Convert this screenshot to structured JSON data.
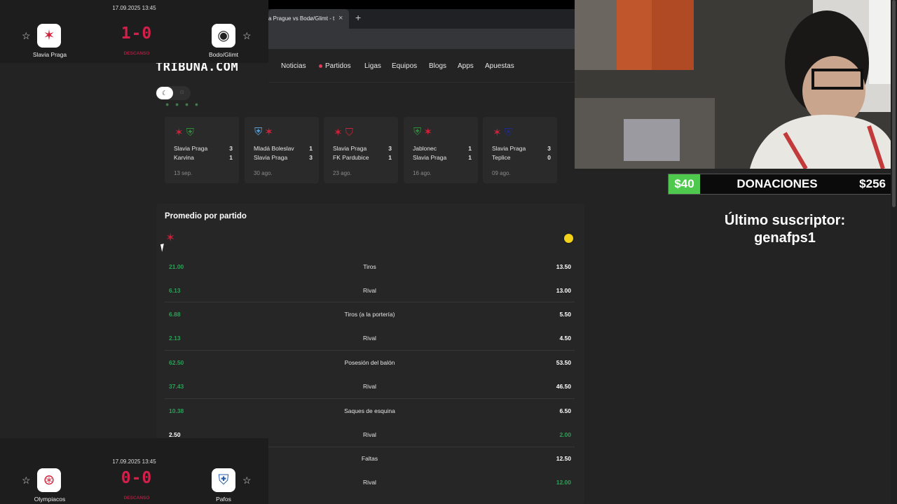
{
  "browser": {
    "tab_title": "a Prague vs Bodø/Glimt - t",
    "close_glyph": "×",
    "new_tab_glyph": "+"
  },
  "site": {
    "logo": "TRIBUNA.COM",
    "nav": [
      "Noticias",
      "Partidos",
      "Ligas",
      "Equipos",
      "Blogs",
      "Apps",
      "Apuestas"
    ],
    "active_nav": "Partidos",
    "theme_toggle": {
      "dark_icon": "moon-icon",
      "light_icon": "sun-icon"
    }
  },
  "recent_matches": [
    {
      "home": "Slavia Praga",
      "home_score": "3",
      "away": "Karvina",
      "away_score": "1",
      "date": "13 sep."
    },
    {
      "home": "Mladá Boleslav",
      "home_score": "1",
      "away": "Slavia Praga",
      "away_score": "3",
      "date": "30 ago."
    },
    {
      "home": "Slavia Praga",
      "home_score": "3",
      "away": "FK Pardubice",
      "away_score": "1",
      "date": "23 ago."
    },
    {
      "home": "Jablonec",
      "home_score": "1",
      "away": "Slavia Praga",
      "away_score": "1",
      "date": "16 ago."
    },
    {
      "home": "Slavia Praga",
      "home_score": "3",
      "away": "Teplice",
      "away_score": "0",
      "date": "09 ago."
    }
  ],
  "stats": {
    "title": "Promedio por partido",
    "rows": [
      {
        "label": "Tiros",
        "left": "21.00",
        "right": "13.50",
        "left_hi": true,
        "right_hi": false
      },
      {
        "label": "Rival",
        "left": "6.13",
        "right": "13.00",
        "left_hi": true,
        "right_hi": false
      },
      {
        "label": "Tiros (a la portería)",
        "left": "6.88",
        "right": "5.50",
        "left_hi": true,
        "right_hi": false
      },
      {
        "label": "Rival",
        "left": "2.13",
        "right": "4.50",
        "left_hi": true,
        "right_hi": false
      },
      {
        "label": "Posesión del balón",
        "left": "62.50",
        "right": "53.50",
        "left_hi": true,
        "right_hi": false
      },
      {
        "label": "Rival",
        "left": "37.43",
        "right": "46.50",
        "left_hi": true,
        "right_hi": false
      },
      {
        "label": "Saques de esquina",
        "left": "10.38",
        "right": "6.50",
        "left_hi": true,
        "right_hi": false
      },
      {
        "label": "Rival",
        "left": "2.50",
        "right": "2.00",
        "left_hi": false,
        "right_hi": true
      },
      {
        "label": "Faltas",
        "left": "",
        "right": "12.50",
        "left_hi": false,
        "right_hi": false
      },
      {
        "label": "Rival",
        "left": "",
        "right": "12.00",
        "left_hi": false,
        "right_hi": true
      }
    ]
  },
  "scoreboards": [
    {
      "datetime": "17.09.2025 13:45",
      "home": "Slavia Praga",
      "away": "Bodo/Glimt",
      "score": "1-0",
      "status": "DESCANSO"
    },
    {
      "datetime": "17.09.2025 13:45",
      "home": "Olympiacos",
      "away": "Pafos",
      "score": "0-0",
      "status": "DESCANSO"
    }
  ],
  "stream": {
    "donation_left": "$40",
    "donation_title": "DONACIONES",
    "donation_right": "$256",
    "last_sub_label": "Último suscriptor:",
    "last_sub_name": "genafps1"
  },
  "colors": {
    "accent_red": "#d41f4a",
    "stat_green": "#2e9e58",
    "donation_green": "#4ec94e"
  }
}
